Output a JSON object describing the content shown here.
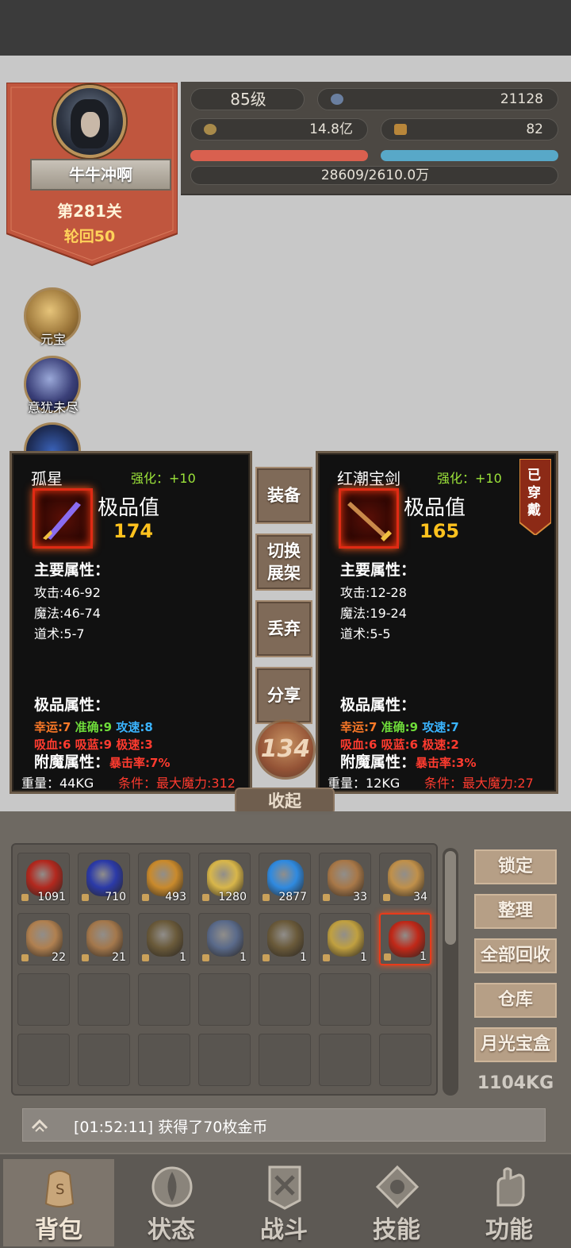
{
  "player": {
    "level": "85级",
    "name": "牛牛冲啊",
    "stage": "第281关",
    "cycle": "轮回50",
    "power": "21128",
    "gold": "14.8亿",
    "ingots": "82",
    "exp": "28609/2610.0万"
  },
  "side_icons": [
    {
      "label": "元宝"
    },
    {
      "label": "意犹未尽"
    }
  ],
  "card_left": {
    "name": "孤星",
    "enhance": "强化：+10",
    "grade": "极品值",
    "score": "174",
    "main_title": "主要属性：",
    "attrs": [
      "攻击:46-92",
      "魔法:46-74",
      "道术:5-7"
    ],
    "rare_title": "极品属性：",
    "rare_line1": {
      "a": "幸运:7",
      "b": "准确:9",
      "c": "攻速:8"
    },
    "rare_line2": "吸血:6 吸蓝:9 极速:3",
    "enchant_label": "附魔属性：",
    "enchant_value": "暴击率:7%",
    "weight": "重量：44KG",
    "condition": "条件：最大魔力:312"
  },
  "card_right": {
    "name": "红潮宝剑",
    "enhance": "强化：+10",
    "grade": "极品值",
    "score": "165",
    "main_title": "主要属性：",
    "attrs": [
      "攻击:12-28",
      "魔法:19-24",
      "道术:5-5"
    ],
    "rare_title": "极品属性：",
    "rare_line1": {
      "a": "幸运:7",
      "b": "准确:9",
      "c": "攻速:7"
    },
    "rare_line2": "吸血:6 吸蓝:6 极速:2",
    "enchant_label": "附魔属性：",
    "enchant_value": "暴击率:3%",
    "weight": "重量：12KG",
    "condition": "条件：最大魔力:27",
    "worn": "已穿戴"
  },
  "mid_buttons": {
    "equip": "装备",
    "switch_line1": "切换",
    "switch_line2": "展架",
    "discard": "丢弃",
    "share": "分享",
    "orb": "134",
    "collapse": "收起"
  },
  "inventory": {
    "items": [
      {
        "qty": "1091",
        "color": "#b2281e"
      },
      {
        "qty": "710",
        "color": "#2b3aa8"
      },
      {
        "qty": "493",
        "color": "#c98a2c"
      },
      {
        "qty": "1280",
        "color": "#d8b64a"
      },
      {
        "qty": "2877",
        "color": "#2f8ae0"
      },
      {
        "qty": "33",
        "color": "#a87848"
      },
      {
        "qty": "34",
        "color": "#c0904a"
      },
      {
        "qty": "22",
        "color": "#b08050"
      },
      {
        "qty": "21",
        "color": "#a4784c"
      },
      {
        "qty": "1",
        "color": "#6a5a3a"
      },
      {
        "qty": "1",
        "color": "#5a6a8a"
      },
      {
        "qty": "1",
        "color": "#6a5a3a"
      },
      {
        "qty": "1",
        "color": "#c0a040"
      },
      {
        "qty": "1",
        "color": "#c02818"
      }
    ],
    "weight": "1104KG"
  },
  "side_buttons": [
    "锁定",
    "整理",
    "全部回收",
    "仓库",
    "月光宝盒"
  ],
  "message": "[01:52:11] 获得了70枚金币",
  "nav": [
    "背包",
    "状态",
    "战斗",
    "技能",
    "功能"
  ],
  "colors": {
    "hp_bar": "#d9604f",
    "mp_bar": "#58a8c8",
    "rare_orange": "#ff7a28",
    "rare_green": "#6fdc3a",
    "rare_blue": "#3ab4ff",
    "rare_red": "#ff3b2f",
    "enhance_green": "#9ce33a",
    "score_gold": "#ffc21e"
  }
}
